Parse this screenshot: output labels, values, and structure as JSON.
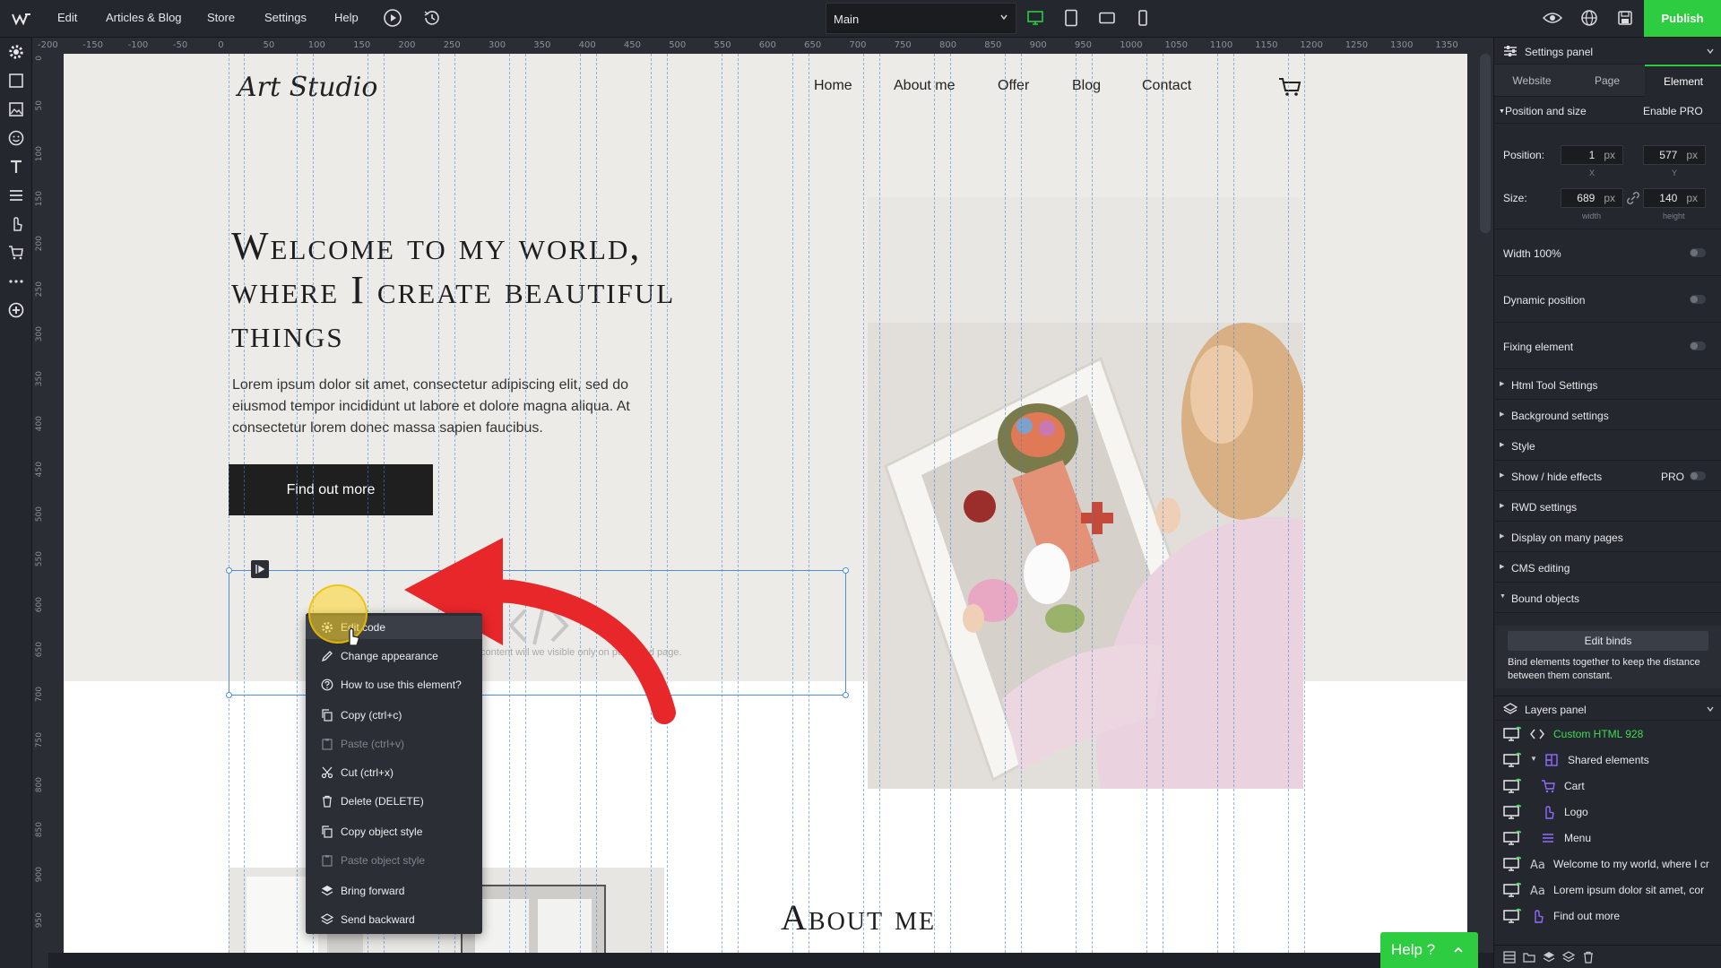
{
  "topbar": {
    "menu": [
      "Edit",
      "Articles & Blog",
      "Store",
      "Settings",
      "Help"
    ],
    "page_select": "Main",
    "publish_label": "Publish"
  },
  "ruler": {
    "top": [
      "-200",
      "-150",
      "-100",
      "-50",
      "0",
      "50",
      "100",
      "150",
      "200",
      "250",
      "300",
      "350",
      "400",
      "450",
      "500",
      "550",
      "600",
      "650",
      "700",
      "750",
      "800",
      "850",
      "900",
      "950",
      "1000",
      "1050",
      "1100",
      "1150",
      "1200",
      "1250",
      "1300",
      "1350"
    ],
    "left": [
      "0",
      "50",
      "100",
      "150",
      "200",
      "250",
      "300",
      "350",
      "400",
      "450",
      "500",
      "550",
      "600",
      "650",
      "700",
      "750",
      "800",
      "850",
      "900",
      "950"
    ]
  },
  "site": {
    "logo": "Art Studio",
    "nav": [
      "Home",
      "About me",
      "Offer",
      "Blog",
      "Contact"
    ],
    "headline": "Welcome to my world, where I create beautiful things",
    "body": "Lorem ipsum dolor sit amet, consectetur adipiscing elit, sed do eiusmod tempor incididunt ut labore et dolore magna aliqua. At consectetur lorem donec massa sapien faucibus.",
    "cta": "Find out more",
    "html_placeholder": "ment's content will we visible only on published page.",
    "about_title": "About me"
  },
  "context_menu": [
    {
      "label": "Edit code",
      "icon": "gear-icon",
      "enabled": true
    },
    {
      "label": "Change appearance",
      "icon": "pencil-icon",
      "enabled": true
    },
    {
      "label": "How to use this element?",
      "icon": "question-icon",
      "enabled": true
    },
    {
      "label": "Copy (ctrl+c)",
      "icon": "copy-icon",
      "enabled": true
    },
    {
      "label": "Paste (ctrl+v)",
      "icon": "paste-icon",
      "enabled": false
    },
    {
      "label": "Cut (ctrl+x)",
      "icon": "scissors-icon",
      "enabled": true
    },
    {
      "label": "Delete (DELETE)",
      "icon": "trash-icon",
      "enabled": true
    },
    {
      "label": "Copy object style",
      "icon": "copy-style-icon",
      "enabled": true
    },
    {
      "label": "Paste object style",
      "icon": "paste-style-icon",
      "enabled": false
    },
    {
      "label": "Bring forward",
      "icon": "layer-up-icon",
      "enabled": true
    },
    {
      "label": "Send backward",
      "icon": "layer-down-icon",
      "enabled": true
    }
  ],
  "settings_panel": {
    "title": "Settings panel",
    "tabs": [
      "Website",
      "Page",
      "Element"
    ],
    "active_tab": "Element",
    "position_size": {
      "title": "Position and size",
      "pro_label": "Enable PRO",
      "position_label": "Position:",
      "size_label": "Size:",
      "pos_x": "1",
      "pos_y": "577",
      "width": "689",
      "height": "140",
      "unit": "px",
      "x_label": "X",
      "y_label": "Y",
      "width_label": "width",
      "height_label": "height"
    },
    "toggles": [
      "Width 100%",
      "Dynamic position",
      "Fixing element"
    ],
    "sections": [
      "Html Tool Settings",
      "Background settings",
      "Style",
      "Show / hide effects",
      "RWD settings",
      "Display on many pages",
      "CMS editing",
      "Bound objects"
    ],
    "show_hide_badge": "PRO",
    "edit_binds": "Edit binds",
    "binds_help": "Bind elements together to keep the distance between them constant."
  },
  "layers_panel": {
    "title": "Layers panel",
    "items": [
      {
        "name": "Custom HTML 928",
        "icon": "code-icon",
        "active": true
      },
      {
        "name": "Shared elements",
        "icon": "group-icon",
        "active": false
      },
      {
        "name": "Cart",
        "icon": "cart-icon",
        "active": false
      },
      {
        "name": "Logo",
        "icon": "touch-icon",
        "active": false
      },
      {
        "name": "Menu",
        "icon": "menu-icon",
        "active": false
      },
      {
        "name": "Welcome to my world, where I cr",
        "icon": "text-icon",
        "active": false
      },
      {
        "name": "Lorem ipsum dolor sit amet, cor",
        "icon": "text-icon",
        "active": false
      },
      {
        "name": "Find out more",
        "icon": "touch-icon",
        "active": false
      }
    ]
  },
  "help_label": "Help ?",
  "colors": {
    "accent_green": "#2ecc40",
    "selection_blue": "#4a8fe0",
    "arrow_red": "#e8272b",
    "active_layer": "#3ddc56"
  }
}
